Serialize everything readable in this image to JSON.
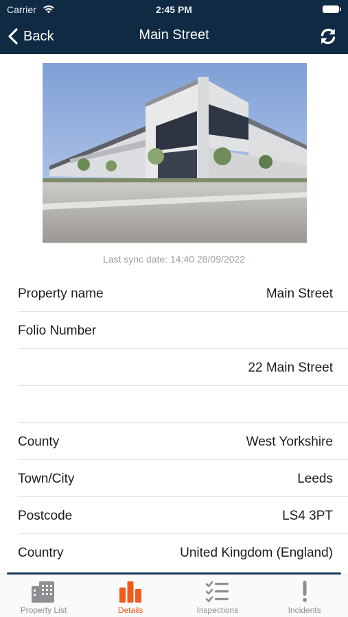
{
  "status_bar": {
    "carrier": "Carrier",
    "time": "2:45 PM"
  },
  "nav": {
    "back_label": "Back",
    "title": "Main Street"
  },
  "sync": {
    "text": "Last sync date: 14:40 28/09/2022"
  },
  "details": [
    {
      "key": "Property name",
      "value": "Main Street"
    },
    {
      "key": "Folio Number",
      "value": ""
    },
    {
      "key": "",
      "value": "22 Main Street"
    },
    {
      "key": "",
      "value": ""
    },
    {
      "key": "County",
      "value": "West Yorkshire"
    },
    {
      "key": "Town/City",
      "value": "Leeds"
    },
    {
      "key": "Postcode",
      "value": "LS4 3PT"
    },
    {
      "key": "Country",
      "value": "United Kingdom (England)"
    }
  ],
  "tabs": [
    {
      "label": "Property List",
      "icon": "buildings-icon",
      "active": false
    },
    {
      "label": "Details",
      "icon": "bar-chart-icon",
      "active": true
    },
    {
      "label": "Inspections",
      "icon": "checklist-icon",
      "active": false
    },
    {
      "label": "Incidents",
      "icon": "exclamation-icon",
      "active": false
    }
  ],
  "colors": {
    "nav_bg": "#102a43",
    "accent": "#ef5a1f",
    "inactive": "#8e8e93"
  }
}
